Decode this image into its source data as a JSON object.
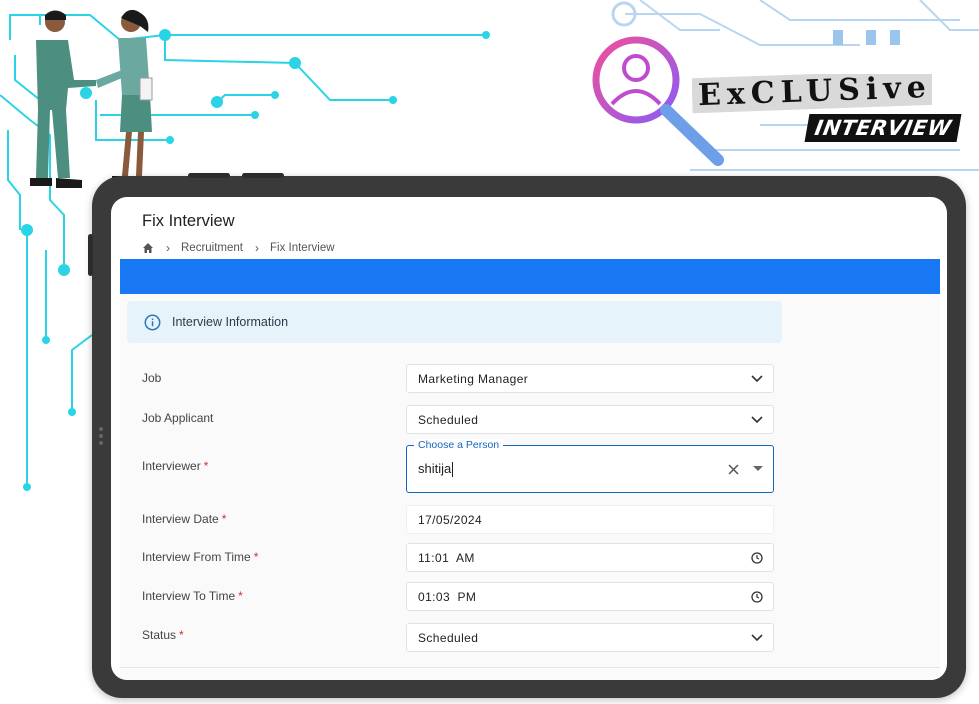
{
  "header": {
    "logo_big": "ExCLUSive",
    "logo_sub": "INTERVIEW"
  },
  "page": {
    "title": "Fix Interview",
    "breadcrumb": [
      "Recruitment",
      "Fix Interview"
    ]
  },
  "info_panel": {
    "label": "Interview Information"
  },
  "form": {
    "job": {
      "label": "Job",
      "value": "Marketing Manager"
    },
    "job_applicant": {
      "label": "Job Applicant",
      "value": "Scheduled"
    },
    "interviewer": {
      "label": "Interviewer",
      "legend": "Choose a Person",
      "value": "shitija"
    },
    "interview_date": {
      "label": "Interview Date",
      "value": "17/05/2024"
    },
    "from_time": {
      "label": "Interview From Time",
      "value": "11:01  AM"
    },
    "to_time": {
      "label": "Interview To Time",
      "value": "01:03  PM"
    },
    "status": {
      "label": "Status",
      "value": "Scheduled"
    },
    "required_mark": "*"
  },
  "colors": {
    "accent_blue": "#1877f2",
    "focus_blue": "#1565c0",
    "circuit_cyan": "#2ad4e6",
    "required_red": "#d32f2f"
  }
}
